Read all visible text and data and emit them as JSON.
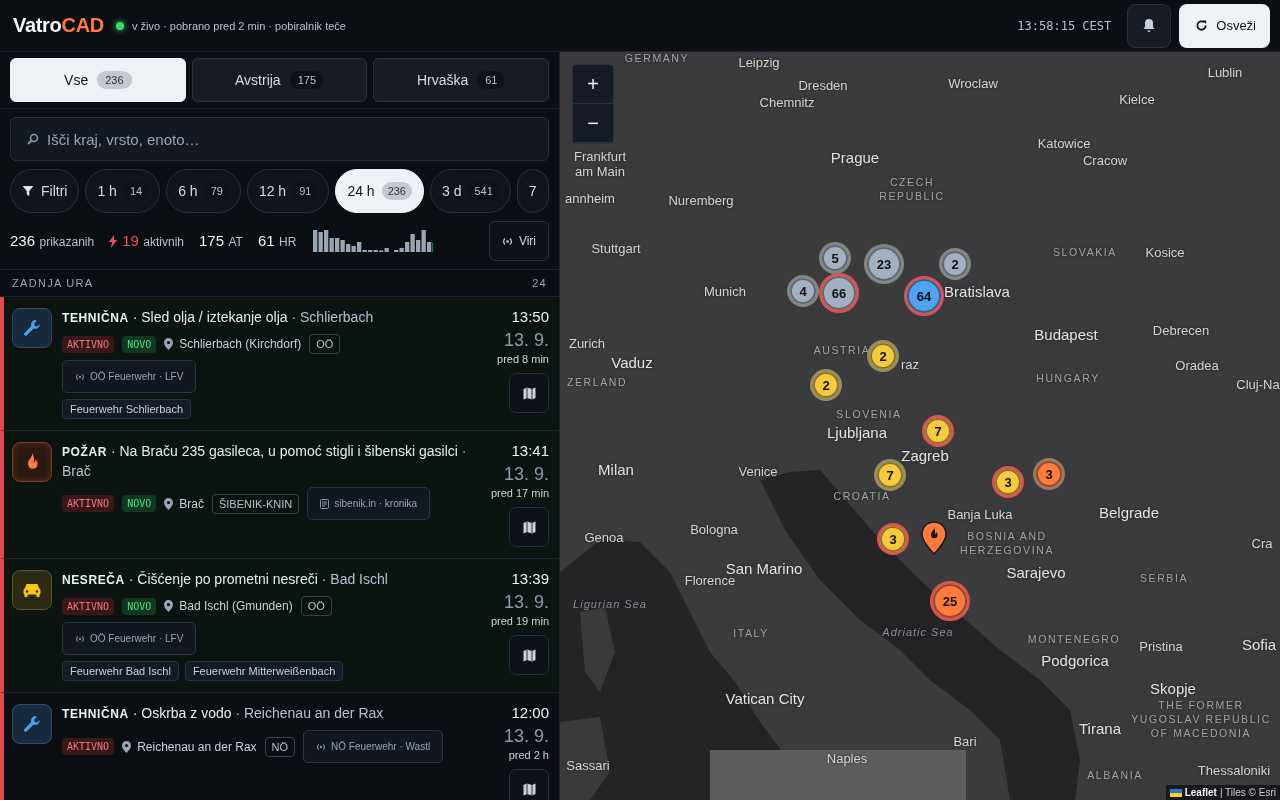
{
  "header": {
    "logo": {
      "main": "Vatro",
      "accent": "CAD"
    },
    "live": true,
    "status": "v živo · pobrano pred 2 min · pobiralnik teče",
    "clock": "13:58:15 CEST",
    "refresh_label": "Osveži"
  },
  "region_tabs": [
    {
      "label": "Vse",
      "count": "236",
      "selected": true
    },
    {
      "label": "Avstrija",
      "count": "175",
      "selected": false
    },
    {
      "label": "Hrvaška",
      "count": "61",
      "selected": false
    }
  ],
  "search": {
    "placeholder": "Išči kraj, vrsto, enoto…"
  },
  "time_filters": {
    "filter_label": "Filtri",
    "chips": [
      {
        "label": "1 h",
        "count": "14",
        "selected": false
      },
      {
        "label": "6 h",
        "count": "79",
        "selected": false
      },
      {
        "label": "12 h",
        "count": "91",
        "selected": false
      },
      {
        "label": "24 h",
        "count": "236",
        "selected": true
      },
      {
        "label": "3 d",
        "count": "541",
        "selected": false
      },
      {
        "label": "7",
        "selected": false
      }
    ]
  },
  "stats": [
    {
      "number": "236",
      "suffix": "prikazanih",
      "kind": "total"
    },
    {
      "number": "19",
      "suffix": "aktivnih",
      "kind": "active"
    },
    {
      "number": "175",
      "suffix": "AT",
      "kind": "plain"
    },
    {
      "number": "61",
      "suffix": "HR",
      "kind": "plain"
    }
  ],
  "sources_button": "Viri",
  "section": {
    "title": "ZADNJA URA",
    "count": "24"
  },
  "incidents": [
    {
      "kind": "technical",
      "category": "TEHNIČNA",
      "title": "· Sled olja / iztekanje olja",
      "place": "· Schlierbach",
      "active": true,
      "badges": [
        {
          "text": "AKTIVNO",
          "kind": "active"
        },
        {
          "text": "NOVO",
          "kind": "new"
        }
      ],
      "location": "Schlierbach (Kirchdorf)",
      "region": "OÖ",
      "source": {
        "kind": "feed",
        "text": "OÖ Feuerwehr · LFV"
      },
      "units": [
        "Feuerwehr Schlierbach"
      ],
      "time": "13:50",
      "date": "13. 9.",
      "ago": "pred 8 min"
    },
    {
      "kind": "fire",
      "category": "POŽAR",
      "title": "· Na Braču 235 gasileca, u pomoć stigli i šibenski gasilci",
      "place": "· Brač",
      "active": true,
      "badges": [
        {
          "text": "AKTIVNO",
          "kind": "active"
        },
        {
          "text": "NOVO",
          "kind": "new"
        }
      ],
      "location": "Brač",
      "region": "ŠIBENIK-KNIN",
      "source": {
        "kind": "news",
        "text": "sibenik.in · kronika"
      },
      "time": "13:41",
      "date": "13. 9.",
      "ago": "pred 17 min"
    },
    {
      "kind": "accident",
      "category": "NESREČA",
      "title": "· Čišćenje po prometni nesreči",
      "place": "· Bad Ischl",
      "active": true,
      "badges": [
        {
          "text": "AKTIVNO",
          "kind": "active"
        },
        {
          "text": "NOVO",
          "kind": "new"
        }
      ],
      "location": "Bad Ischl (Gmunden)",
      "region": "OÖ",
      "source": {
        "kind": "feed",
        "text": "OÖ Feuerwehr · LFV"
      },
      "units": [
        "Feuerwehr Bad Ischl",
        "Feuerwehr Mitterweißenbach"
      ],
      "time": "13:39",
      "date": "13. 9.",
      "ago": "pred 19 min"
    },
    {
      "kind": "technical",
      "category": "TEHNIČNA",
      "title": "· Oskrba z vodo",
      "place": "· Reichenau an der Rax",
      "active": true,
      "badges": [
        {
          "text": "AKTIVNO",
          "kind": "active"
        }
      ],
      "location": "Reichenau an der Rax",
      "region": "NÖ",
      "source": {
        "kind": "feed",
        "text": "NÖ Feuerwehr · Wastl"
      },
      "time": "12:00",
      "date": "13. 9.",
      "ago": "pred 2 h"
    }
  ],
  "map": {
    "labels": [
      {
        "text": "GERMANY",
        "kind": "country"
      },
      {
        "text": "Leipzig",
        "kind": "city"
      },
      {
        "text": "Dresden",
        "kind": "city"
      },
      {
        "text": "Chemnitz",
        "kind": "city"
      },
      {
        "text": "Wroclaw",
        "kind": "city"
      },
      {
        "text": "Lublin",
        "kind": "city"
      },
      {
        "text": "Kielce",
        "kind": "city"
      },
      {
        "text": "Katowice",
        "kind": "city"
      },
      {
        "text": "Frankfurt am Main",
        "kind": "city"
      },
      {
        "text": "Prague",
        "kind": "capital"
      },
      {
        "text": "Cracow",
        "kind": "city"
      },
      {
        "text": "annheim",
        "kind": "city"
      },
      {
        "text": "Nuremberg",
        "kind": "city"
      },
      {
        "text": "CZECH REPUBLIC",
        "kind": "country"
      },
      {
        "text": "Stuttgart",
        "kind": "city"
      },
      {
        "text": "SLOVAKIA",
        "kind": "country"
      },
      {
        "text": "Kosice",
        "kind": "city"
      },
      {
        "text": "Munich",
        "kind": "city"
      },
      {
        "text": "Bratislava",
        "kind": "capital"
      },
      {
        "text": "Budapest",
        "kind": "capital"
      },
      {
        "text": "Debrecen",
        "kind": "city"
      },
      {
        "text": "Zurich",
        "kind": "city"
      },
      {
        "text": "Vaduz",
        "kind": "capital"
      },
      {
        "text": "AUSTRIA",
        "kind": "country"
      },
      {
        "text": "raz",
        "kind": "city"
      },
      {
        "text": "Oradea",
        "kind": "city"
      },
      {
        "text": "HUNGARY",
        "kind": "country"
      },
      {
        "text": "ZERLAND",
        "kind": "country"
      },
      {
        "text": "Cluj-Na",
        "kind": "city"
      },
      {
        "text": "SLOVENIA",
        "kind": "country"
      },
      {
        "text": "Ljubljana",
        "kind": "capital"
      },
      {
        "text": "Zagreb",
        "kind": "capital"
      },
      {
        "text": "Milan",
        "kind": "capital"
      },
      {
        "text": "Venice",
        "kind": "city"
      },
      {
        "text": "CROATIA",
        "kind": "country"
      },
      {
        "text": "Banja Luka",
        "kind": "city"
      },
      {
        "text": "Belgrade",
        "kind": "capital"
      },
      {
        "text": "Genoa",
        "kind": "city"
      },
      {
        "text": "Bologna",
        "kind": "city"
      },
      {
        "text": "BOSNIA AND HERZEGOVINA",
        "kind": "country"
      },
      {
        "text": "Cra",
        "kind": "city"
      },
      {
        "text": "San Marino",
        "kind": "capital"
      },
      {
        "text": "Sarajevo",
        "kind": "capital"
      },
      {
        "text": "Florence",
        "kind": "city"
      },
      {
        "text": "SERBIA",
        "kind": "country"
      },
      {
        "text": "Ligurian Sea",
        "kind": "sea"
      },
      {
        "text": "ITALY",
        "kind": "country"
      },
      {
        "text": "Adriatic Sea",
        "kind": "sea"
      },
      {
        "text": "MONTENEGRO",
        "kind": "country"
      },
      {
        "text": "Pristina",
        "kind": "city"
      },
      {
        "text": "Sofia",
        "kind": "capital"
      },
      {
        "text": "Podgorica",
        "kind": "capital"
      },
      {
        "text": "Skopje",
        "kind": "capital"
      },
      {
        "text": "THE FORMER YUGOSLAV REPUBLIC OF MACEDONIA",
        "kind": "country"
      },
      {
        "text": "Vatican City",
        "kind": "capital"
      },
      {
        "text": "Tirana",
        "kind": "capital"
      },
      {
        "text": "Bari",
        "kind": "city"
      },
      {
        "text": "Naples",
        "kind": "city"
      },
      {
        "text": "Sassari",
        "kind": "city"
      },
      {
        "text": "ALBANIA",
        "kind": "country"
      },
      {
        "text": "Thessaloniki",
        "kind": "city"
      }
    ],
    "clusters": [
      {
        "count": "5",
        "color": "#a3b0c2",
        "active": false
      },
      {
        "count": "23",
        "color": "#a3b0c2",
        "active": false
      },
      {
        "count": "2",
        "color": "#a3b0c2",
        "active": false
      },
      {
        "count": "4",
        "color": "#a3b0c2",
        "active": false
      },
      {
        "count": "66",
        "color": "#a3b0c2",
        "active": true
      },
      {
        "count": "64",
        "color": "#4fa3f0",
        "active": true
      },
      {
        "count": "2",
        "color": "#f5cb3c",
        "active": false
      },
      {
        "count": "2",
        "color": "#f5cb3c",
        "active": false
      },
      {
        "count": "7",
        "color": "#f5cb3c",
        "active": true
      },
      {
        "count": "7",
        "color": "#f5cb3c",
        "active": false
      },
      {
        "count": "3",
        "color": "#f5cb3c",
        "active": true
      },
      {
        "count": "3",
        "color": "#ff7a3d",
        "active": false
      },
      {
        "count": "3",
        "color": "#f5cb3c",
        "active": true
      },
      {
        "count": "25",
        "color": "#ff7a3d",
        "active": true
      }
    ],
    "pins": [
      {
        "kind": "fire"
      }
    ],
    "zoom_in": "+",
    "zoom_out": "−",
    "attribution": {
      "link": "Leaflet",
      "text": "| Tiles © Esri"
    }
  }
}
